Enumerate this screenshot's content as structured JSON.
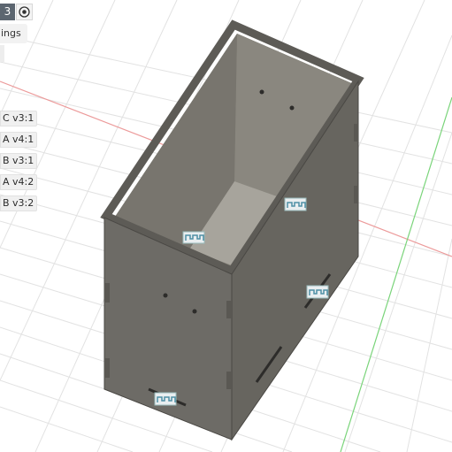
{
  "toolbar": {
    "badge_label": "3"
  },
  "settings_label": "ings",
  "component_chips": [
    "C v3:1",
    "A v4:1",
    "B v3:1",
    "A v4:2",
    "B v3:2"
  ],
  "colors": {
    "axis_red": "#e98f8f",
    "axis_green": "#6fd36f",
    "grid": "#dedede",
    "box_face": "#6c6a65",
    "box_inner": "#a8a59e",
    "joint_marker": "#7fb3c3"
  },
  "icons": [
    "radio-target-icon",
    "joint-marker-icon"
  ]
}
